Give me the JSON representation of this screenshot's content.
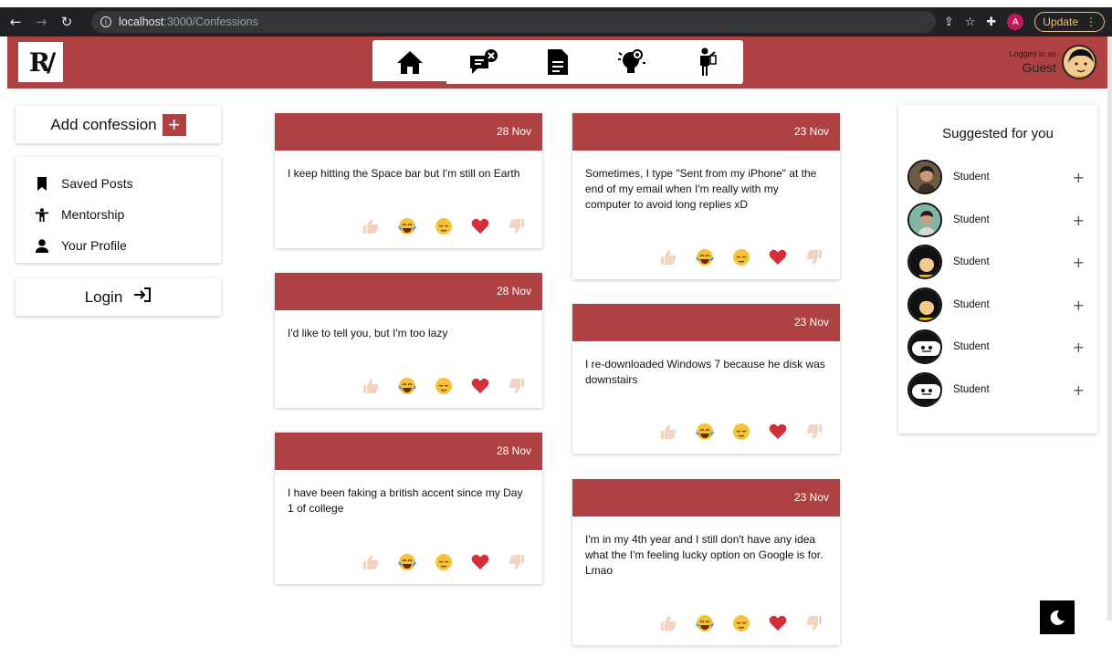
{
  "browser": {
    "url_host": "localhost",
    "url_path": ":3000/Confessions",
    "update_label": "Update",
    "profile_letter": "A"
  },
  "header": {
    "logo_text": "R/",
    "logged_in_label": "Logged in as",
    "user_name": "Guest"
  },
  "sidebar": {
    "add_confession_label": "Add confession",
    "menu": [
      {
        "label": "Saved Posts",
        "icon": "bookmark-icon"
      },
      {
        "label": "Mentorship",
        "icon": "person-raised-icon"
      },
      {
        "label": "Your Profile",
        "icon": "user-icon"
      }
    ],
    "login_label": "Login"
  },
  "posts_left": [
    {
      "date": "28 Nov",
      "text": "I keep hitting the Space bar but I'm still on Earth"
    },
    {
      "date": "28 Nov",
      "text": "I'd like to tell you, but I'm too lazy"
    },
    {
      "date": "28 Nov",
      "text": "I have been faking a british accent since my Day 1 of college"
    }
  ],
  "posts_right": [
    {
      "date": "23 Nov",
      "text": "Sometimes, I type \"Sent from my iPhone\" at the end of my email when I'm really with my computer to avoid long replies xD"
    },
    {
      "date": "23 Nov",
      "text": "I re-downloaded Windows 7 because he disk was downstairs"
    },
    {
      "date": "23 Nov",
      "text": "I'm in my 4th year and I still don't have any idea what the I'm feeling lucky option on Google is for. Lmao"
    }
  ],
  "suggestions": {
    "title": "Suggested for you",
    "items": [
      {
        "name": "Student"
      },
      {
        "name": "Student"
      },
      {
        "name": "Student"
      },
      {
        "name": "Student"
      },
      {
        "name": "Student"
      },
      {
        "name": "Student"
      }
    ]
  },
  "colors": {
    "brand": "#b04142",
    "chrome": "#202124"
  }
}
